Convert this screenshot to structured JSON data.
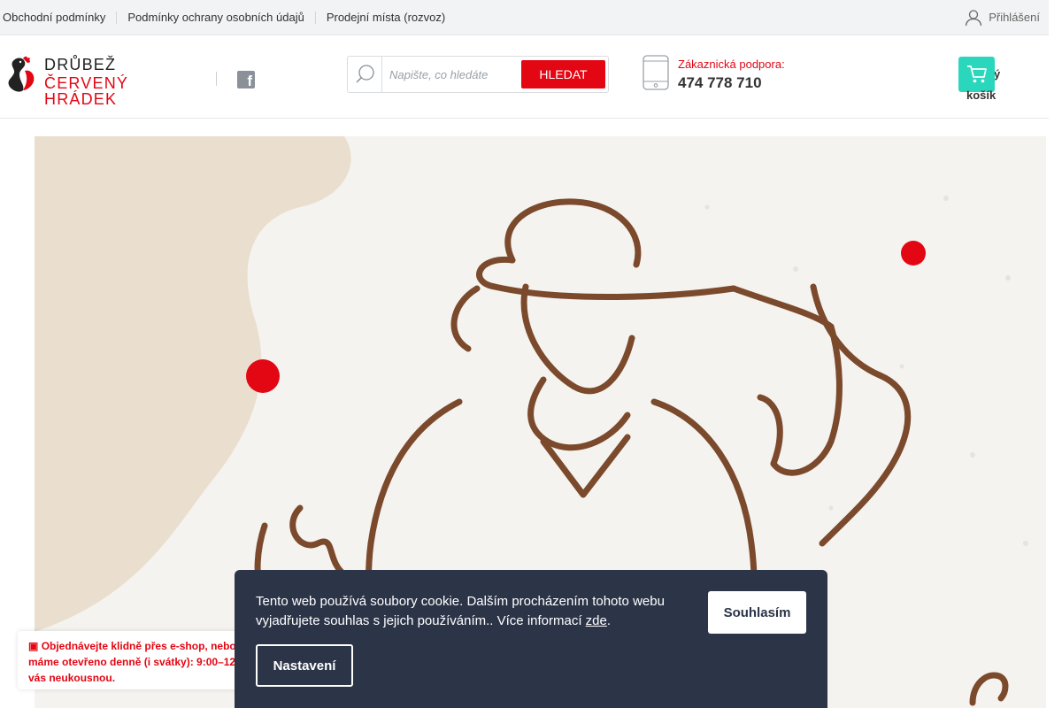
{
  "topbar": {
    "links": [
      "Obchodní podmínky",
      "Podmínky ochrany osobních údajů",
      "Prodejní místa (rozvoz)"
    ],
    "login_label": "Přihlášení"
  },
  "header": {
    "logo_line1": "DRŮBEŽ",
    "logo_line2": "ČERVENÝ HRÁDEK",
    "search_placeholder": "Napište, co hledáte",
    "search_button": "HLEDAT",
    "support_label": "Zákaznická podpora:",
    "support_phone": "474 778 710",
    "cart_line1": "ný",
    "cart_line2": "košík"
  },
  "notice": {
    "icon": "info-icon",
    "line1": "Objednávejte klidně přes e-shop, nebo z",
    "line2": "máme otevřeno denně (i svátky): 9:00–12",
    "line3": "vás neukousnou."
  },
  "cookie": {
    "text": "Tento web používá soubory cookie. Dalším procházením tohoto webu vyjadřujete souhlas s jejich používáním.. Více informací ",
    "link": "zde",
    "link_suffix": ".",
    "agree_button": "Souhlasím",
    "settings_button": "Nastavení"
  },
  "colors": {
    "brand_red": "#e30613",
    "cart_teal": "#2bd7bc",
    "cookie_bg": "#2c3548",
    "illustration_brown": "#7b4a2d",
    "banner_beige": "#eadfcf"
  }
}
